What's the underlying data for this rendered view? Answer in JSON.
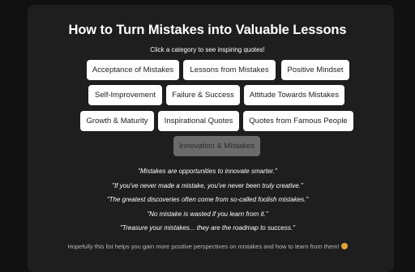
{
  "page": {
    "title": "How to Turn Mistakes into Valuable Lessons",
    "subtitle": "Click a category to see inspiring quotes!",
    "footer": "Hopefully this list helps you gain more positive perspectives on mistakes and how to learn from them!"
  },
  "categories": [
    {
      "label": "Acceptance of Mistakes",
      "active": false
    },
    {
      "label": "Lessons from Mistakes",
      "active": false
    },
    {
      "label": "Positive Mindset",
      "active": false
    },
    {
      "label": "Self-Improvement",
      "active": false
    },
    {
      "label": "Failure & Success",
      "active": false
    },
    {
      "label": "Attitude Towards Mistakes",
      "active": false
    },
    {
      "label": "Growth & Maturity",
      "active": false
    },
    {
      "label": "Inspirational Quotes",
      "active": false
    },
    {
      "label": "Quotes from Famous People",
      "active": false
    },
    {
      "label": "Innovation & Mistakes",
      "active": true
    }
  ],
  "quotes": [
    "\"Mistakes are opportunities to innovate smarter.\"",
    "\"If you've never made a mistake, you've never been truly creative.\"",
    "\"The greatest discoveries often come from so-called foolish mistakes.\"",
    "\"No mistake is wasted if you learn from it.\"",
    "\"Treasure your mistakes... they are the roadmap to success.\""
  ],
  "icons": {
    "footer_icon": "smile-emoji-icon"
  },
  "colors": {
    "background": "#111111",
    "panel": "#1e1e1e",
    "button": "#ffffff",
    "active_button": "#6b6b6b"
  }
}
